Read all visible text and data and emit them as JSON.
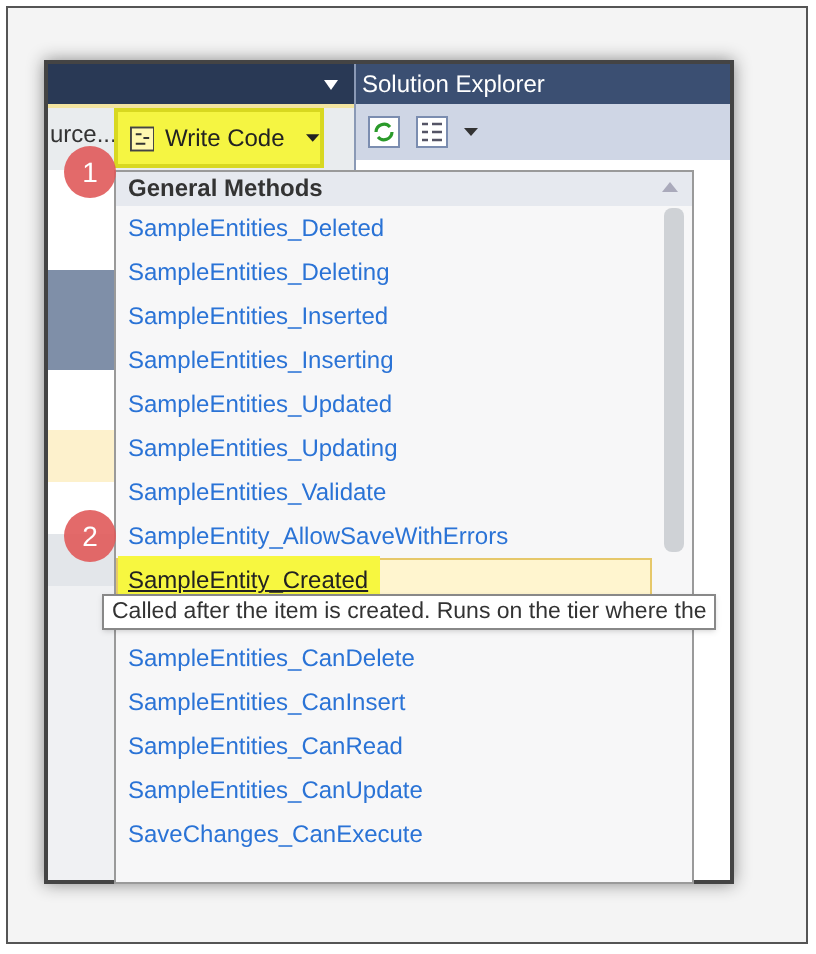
{
  "document_panel": {
    "tab_label": "urce..."
  },
  "write_code_button": {
    "label": "Write Code"
  },
  "solution_explorer": {
    "title": "Solution Explorer"
  },
  "menu": {
    "header": "General Methods",
    "items": [
      {
        "label": "SampleEntities_Deleted",
        "selected": false
      },
      {
        "label": "SampleEntities_Deleting",
        "selected": false
      },
      {
        "label": "SampleEntities_Inserted",
        "selected": false
      },
      {
        "label": "SampleEntities_Inserting",
        "selected": false
      },
      {
        "label": "SampleEntities_Updated",
        "selected": false
      },
      {
        "label": "SampleEntities_Updating",
        "selected": false
      },
      {
        "label": "SampleEntities_Validate",
        "selected": false
      },
      {
        "label": "SampleEntity_AllowSaveWithErrors",
        "selected": false
      },
      {
        "label": "SampleEntity_Created",
        "selected": true
      },
      {
        "label": "SampleEntities_CanDelete",
        "selected": false
      },
      {
        "label": "SampleEntities_CanInsert",
        "selected": false
      },
      {
        "label": "SampleEntities_CanRead",
        "selected": false
      },
      {
        "label": "SampleEntities_CanUpdate",
        "selected": false
      },
      {
        "label": "SaveChanges_CanExecute",
        "selected": false
      }
    ]
  },
  "tooltip": "Called after the item is created.  Runs on the tier where the",
  "callouts": [
    "1",
    "2"
  ]
}
